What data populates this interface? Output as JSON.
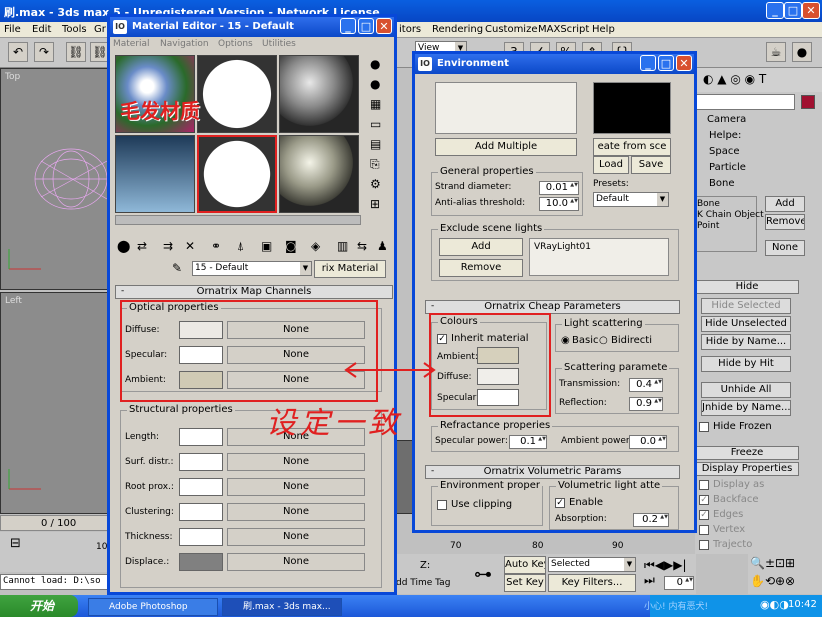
{
  "main_window": {
    "title": "刷.max - 3ds max 5 - Unregistered Version - Network License",
    "menus": [
      "File",
      "Edit",
      "Tools",
      "Gr",
      "itors",
      "Rendering",
      "Customize",
      "MAXScript",
      "Help"
    ],
    "view_dropdown": "View",
    "viewports": {
      "top_label": "Top",
      "left_label": "Left"
    },
    "time_slider": "0 / 100",
    "ruler_ticks": [
      "70",
      "80",
      "90",
      "10",
      "0"
    ],
    "status_text": "Cannot load: D:\\so",
    "auto_key": "Auto Key",
    "set_key": "Set Key",
    "selected": "Selected",
    "key_filters": "Key Filters...",
    "add_time_tag": "dd Time Tag",
    "frame_value": "0",
    "z_label": "Z:"
  },
  "command_panel": {
    "list_items": [
      "Camera",
      "Helpe:",
      "Space",
      "Particle",
      "Bone"
    ],
    "chain_items": [
      "Bone",
      "K Chain Object",
      "Point"
    ],
    "add": "Add",
    "remove": "Remove",
    "none": "None",
    "hide_rollout": "Hide",
    "hide_buttons": [
      "Hide Selected",
      "Hide Unselected",
      "Hide by Name...",
      "Hide by Hit",
      "Unhide All",
      "Jnhide by Name..."
    ],
    "hide_frozen": "Hide Frozen",
    "freeze_rollout": "Freeze",
    "display_props_rollout": "Display Properties",
    "display_items": [
      "Display as",
      "Backface",
      "Edges",
      "Vertex",
      "Trajecto"
    ]
  },
  "material_editor": {
    "title": "Material Editor - 15 - Default",
    "menus": [
      "Material",
      "Navigation",
      "Options",
      "Utilities"
    ],
    "overlay_caption": "毛发材质",
    "material_name": "15 - Default",
    "material_type": "rix Material",
    "rollout": "Ornatrix Map Channels",
    "optical_group": "Optical properties",
    "optical": [
      {
        "label": "Diffuse:",
        "map": "None",
        "color": "#ece9e4"
      },
      {
        "label": "Specular:",
        "map": "None",
        "color": "#ffffff"
      },
      {
        "label": "Ambient:",
        "map": "None",
        "color": "#d0cab4"
      }
    ],
    "structural_group": "Structural properties",
    "structural": [
      {
        "label": "Length:",
        "map": "None",
        "color": "#ffffff"
      },
      {
        "label": "Surf. distr.:",
        "map": "None",
        "color": "#ffffff"
      },
      {
        "label": "Root prox.:",
        "map": "None",
        "color": "#ffffff"
      },
      {
        "label": "Clustering:",
        "map": "None",
        "color": "#ffffff"
      },
      {
        "label": "Thickness:",
        "map": "None",
        "color": "#ffffff"
      },
      {
        "label": "Displace.:",
        "map": "None",
        "color": "#808080"
      }
    ]
  },
  "environment": {
    "title": "Environment",
    "add_multiple": "Add Multiple",
    "create_from": "eate from sce",
    "load": "Load",
    "save": "Save",
    "presets_label": "Presets:",
    "presets_value": "Default",
    "general_group": "General properties",
    "strand_diameter_label": "Strand diameter:",
    "strand_diameter": "0.01",
    "antialias_label": "Anti-alias threshold:",
    "antialias": "10.0",
    "exclude_group": "Exclude scene lights",
    "add": "Add",
    "remove": "Remove",
    "excluded_light": "VRayLight01",
    "cheap_rollout": "Ornatrix Cheap Parameters",
    "colours_group": "Colours",
    "inherit_material": "Inherit material",
    "ambient_label": "Ambient:",
    "diffuse_label": "Diffuse:",
    "specular_label": "Specular:",
    "ambient_color": "#d6d0bc",
    "diffuse_color": "#f0eeea",
    "specular_color": "#ffffff",
    "light_scattering_group": "Light scattering",
    "basic": "Basic",
    "bidirectional": "Bidirecti",
    "scattering_group": "Scattering paramete",
    "transmission_label": "Transmission:",
    "transmission": "0.4",
    "reflection_label": "Reflection:",
    "reflection": "0.9",
    "refractance_group": "Refractance properies",
    "specular_power_label": "Specular power:",
    "specular_power": "0.1",
    "ambient_power_label": "Ambient power:",
    "ambient_power": "0.0",
    "volumetric_rollout": "Ornatrix Volumetric Params",
    "env_group": "Environment proper",
    "use_clipping": "Use clipping",
    "vol_group": "Volumetric light atte",
    "enable": "Enable",
    "absorption_label": "Absorption:",
    "absorption": "0.2"
  },
  "annotation": {
    "text": "设定一致"
  },
  "taskbar": {
    "start": "开始",
    "tasks": [
      "Adobe Photoshop",
      "刷.max - 3ds max..."
    ],
    "tray_text": "小心! 内有恶犬!",
    "clock": "10:42"
  }
}
